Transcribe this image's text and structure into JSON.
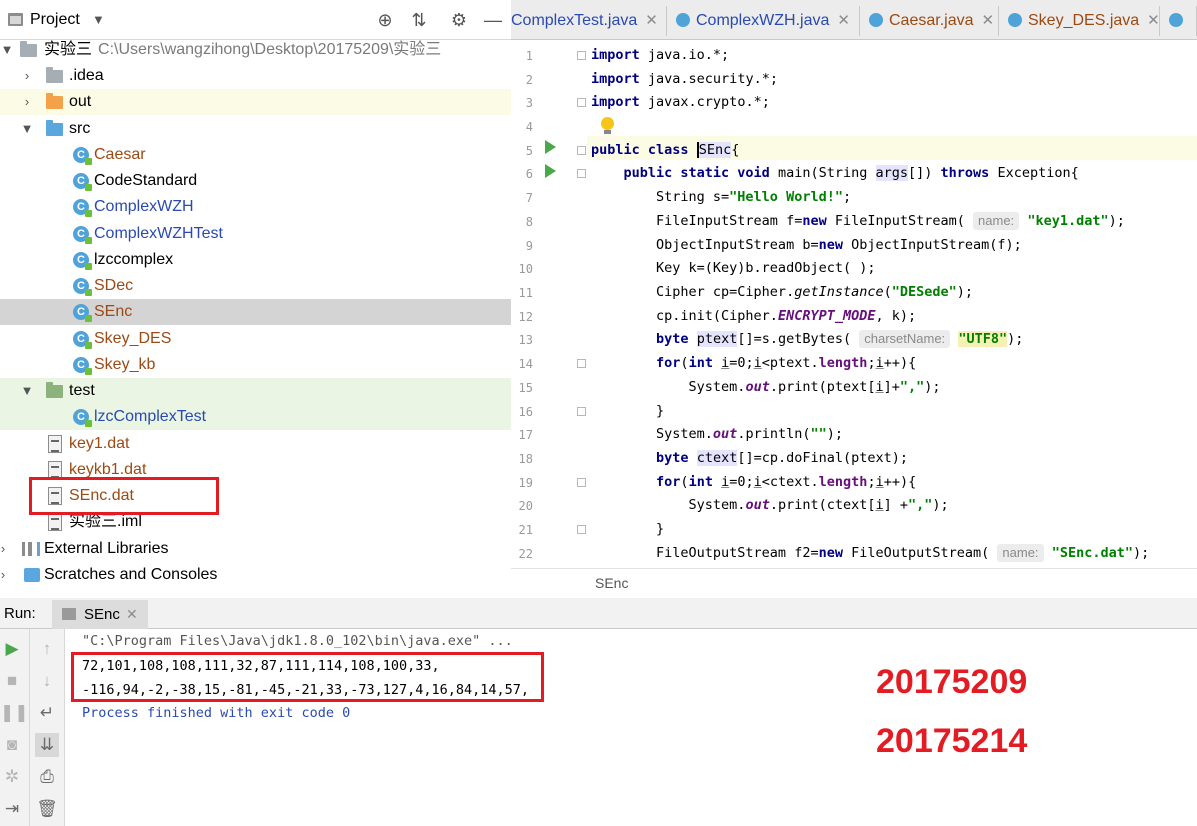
{
  "project_panel": {
    "title": "Project",
    "tree": [
      {
        "label": "实验三",
        "path": "C:\\Users\\wangzihong\\Desktop\\20175209\\实验三"
      },
      {
        "label": ".idea"
      },
      {
        "label": "out"
      },
      {
        "label": "src"
      },
      {
        "label": "Caesar"
      },
      {
        "label": "CodeStandard"
      },
      {
        "label": "ComplexWZH"
      },
      {
        "label": "ComplexWZHTest"
      },
      {
        "label": "lzccomplex"
      },
      {
        "label": "SDec"
      },
      {
        "label": "SEnc"
      },
      {
        "label": "Skey_DES"
      },
      {
        "label": "Skey_kb"
      },
      {
        "label": "test"
      },
      {
        "label": "lzcComplexTest"
      },
      {
        "label": "key1.dat"
      },
      {
        "label": "keykb1.dat"
      },
      {
        "label": "SEnc.dat"
      },
      {
        "label": "实验三.iml"
      },
      {
        "label": "External Libraries"
      },
      {
        "label": "Scratches and Consoles"
      }
    ]
  },
  "editor": {
    "tabs": [
      {
        "label": "ComplexTest.java"
      },
      {
        "label": "ComplexWZH.java"
      },
      {
        "label": "Caesar.java"
      },
      {
        "label": "Skey_DES.java"
      }
    ],
    "line_numbers": [
      "1",
      "2",
      "3",
      "4",
      "5",
      "6",
      "7",
      "8",
      "9",
      "10",
      "11",
      "12",
      "13",
      "14",
      "15",
      "16",
      "17",
      "18",
      "19",
      "20",
      "21",
      "22"
    ],
    "hints": {
      "name": "name:",
      "charset": "charsetName:"
    },
    "breadcrumb": "SEnc"
  },
  "run_panel": {
    "label": "Run:",
    "tab": "SEnc",
    "console": [
      "\"C:\\Program Files\\Java\\jdk1.8.0_102\\bin\\java.exe\" ...",
      "72,101,108,108,111,32,87,111,114,108,100,33,",
      "-116,94,-2,-38,15,-81,-45,-21,33,-73,127,4,16,84,14,57,",
      "Process finished with exit code 0"
    ]
  },
  "annotations": {
    "id1": "20175209",
    "id2": "20175214"
  },
  "colors": {
    "highlight_box": "#e31b23",
    "selection": "#d4d4d4",
    "keyword": "#000080",
    "string": "#008000"
  }
}
